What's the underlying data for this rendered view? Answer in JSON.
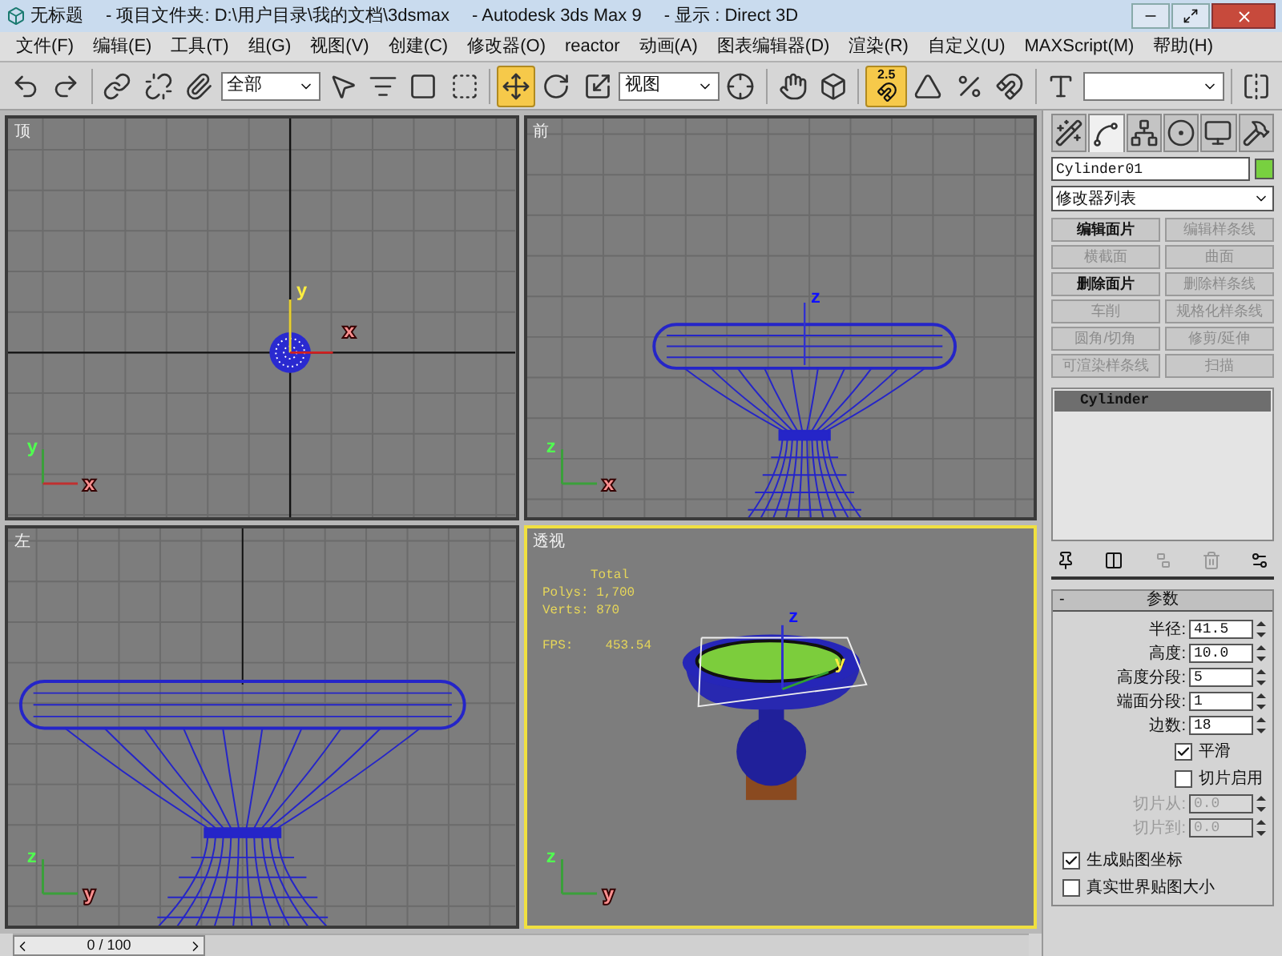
{
  "window": {
    "title": "无标题",
    "project": "- 项目文件夹: D:\\用户目录\\我的文档\\3dsmax",
    "app": "- Autodesk 3ds Max 9",
    "display": "- 显示 : Direct 3D"
  },
  "menu": [
    "文件(F)",
    "编辑(E)",
    "工具(T)",
    "组(G)",
    "视图(V)",
    "创建(C)",
    "修改器(O)",
    "reactor",
    "动画(A)",
    "图表编辑器(D)",
    "渲染(R)",
    "自定义(U)",
    "MAXScript(M)",
    "帮助(H)"
  ],
  "toolbar": [
    {
      "kind": "undo",
      "selected": false
    },
    {
      "kind": "redo",
      "selected": false
    },
    {
      "kind": "separator"
    },
    {
      "kind": "link",
      "selected": false
    },
    {
      "kind": "unlink",
      "selected": false
    },
    {
      "kind": "bind",
      "selected": false
    },
    {
      "kind": "dropdown",
      "value": "全部"
    },
    {
      "kind": "select",
      "selected": false
    },
    {
      "kind": "namelist",
      "selected": false
    },
    {
      "kind": "region",
      "selected": false
    },
    {
      "kind": "crossing",
      "selected": false
    },
    {
      "kind": "separator"
    },
    {
      "kind": "move",
      "selected": true
    },
    {
      "kind": "rotate",
      "selected": false
    },
    {
      "kind": "scale",
      "selected": false
    },
    {
      "kind": "dropdown",
      "value": "视图"
    },
    {
      "kind": "pivot",
      "selected": false
    },
    {
      "kind": "separator"
    },
    {
      "kind": "manipulate",
      "selected": false
    },
    {
      "kind": "box",
      "selected": false
    },
    {
      "kind": "separator"
    },
    {
      "kind": "snap",
      "label": "2.5",
      "selected": true
    },
    {
      "kind": "anglesnap",
      "selected": false
    },
    {
      "kind": "percentsnap",
      "selected": false
    },
    {
      "kind": "spinnersnap",
      "selected": false
    },
    {
      "kind": "separator"
    },
    {
      "kind": "namedsets",
      "selected": false
    },
    {
      "kind": "dropdown"
    },
    {
      "kind": "separator"
    },
    {
      "kind": "mirror",
      "selected": false
    }
  ],
  "viewports": [
    {
      "label": "顶",
      "kind": "top",
      "active": false,
      "corner_axes": [
        "y",
        "x"
      ],
      "gizmo_axes": [
        "y",
        "x"
      ]
    },
    {
      "label": "前",
      "kind": "front",
      "active": false,
      "corner_axes": [
        "z",
        "x"
      ],
      "gizmo_axes": [
        "z"
      ]
    },
    {
      "label": "左",
      "kind": "left",
      "active": false,
      "corner_axes": [
        "z",
        "y"
      ]
    },
    {
      "label": "透视",
      "kind": "perspective",
      "active": true,
      "corner_axes": [
        "z",
        "y"
      ],
      "gizmo_axes": [
        "z",
        "y"
      ],
      "stats": {
        "title": "Total",
        "lines": [
          "Polys: 1,700",
          "Verts: 870"
        ],
        "fps_label": "FPS:",
        "fps": "453.54"
      }
    }
  ],
  "command_panel": {
    "tabs": [
      {
        "kind": "create",
        "selected": false
      },
      {
        "kind": "modify",
        "selected": true
      },
      {
        "kind": "hierarchy",
        "selected": false
      },
      {
        "kind": "motion",
        "selected": false
      },
      {
        "kind": "display",
        "selected": false
      },
      {
        "kind": "utilities",
        "selected": false
      }
    ],
    "object_name": "Cylinder01",
    "modifier_list": "修改器列表",
    "modifier_buttons": [
      {
        "label": "编辑面片",
        "disabled": false
      },
      {
        "label": "编辑样条线",
        "disabled": true
      },
      {
        "label": "横截面",
        "disabled": true
      },
      {
        "label": "曲面",
        "disabled": true
      },
      {
        "label": "删除面片",
        "disabled": false
      },
      {
        "label": "删除样条线",
        "disabled": true
      },
      {
        "label": "车削",
        "disabled": true
      },
      {
        "label": "规格化样条线",
        "disabled": true
      },
      {
        "label": "圆角/切角",
        "disabled": true
      },
      {
        "label": "修剪/延伸",
        "disabled": true
      },
      {
        "label": "可渲染样条线",
        "disabled": true
      },
      {
        "label": "扫描",
        "disabled": true
      }
    ],
    "stack": [
      {
        "label": "Cylinder",
        "selected": true
      }
    ],
    "rollout": {
      "toggle": "-",
      "title": "参数",
      "expanded": true
    },
    "parameters": [
      {
        "kind": "spinner",
        "label": "半径:",
        "value": "41.5",
        "disabled": false
      },
      {
        "kind": "spinner",
        "label": "高度:",
        "value": "10.0",
        "disabled": false
      },
      {
        "kind": "spinner",
        "label": "高度分段:",
        "value": "5",
        "disabled": false
      },
      {
        "kind": "spinner",
        "label": "端面分段:",
        "value": "1",
        "disabled": false
      },
      {
        "kind": "spinner",
        "label": "边数:",
        "value": "18",
        "disabled": false
      },
      {
        "kind": "checkbox",
        "label": "平滑",
        "checked": true,
        "disabled": false
      },
      {
        "kind": "checkbox",
        "label": "切片启用",
        "checked": false,
        "disabled": false
      },
      {
        "kind": "spinner",
        "label": "切片从:",
        "value": "0.0",
        "disabled": true
      },
      {
        "kind": "spinner",
        "label": "切片到:",
        "value": "0.0",
        "disabled": true
      }
    ],
    "mapping": [
      {
        "label": "生成贴图坐标",
        "checked": true
      },
      {
        "label": "真实世界贴图大小",
        "checked": false
      }
    ]
  },
  "timeline": {
    "position": "0 / 100",
    "level": 0
  }
}
